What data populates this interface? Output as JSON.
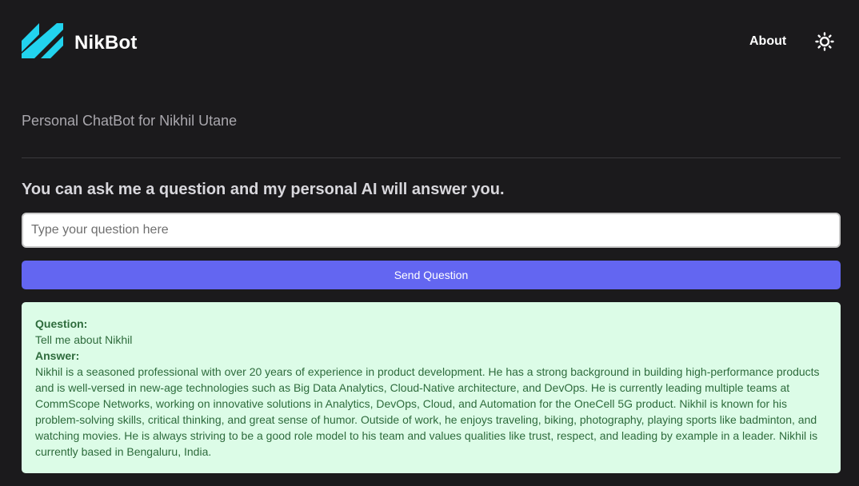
{
  "header": {
    "brand": "NikBot",
    "about_label": "About",
    "logo_icon": "slash-stripes-logo-icon",
    "theme_icon": "sun-icon",
    "logo_color": "#22d3ee"
  },
  "main": {
    "subtitle": "Personal ChatBot for Nikhil Utane",
    "prompt": "You can ask me a question and my personal AI will answer you.",
    "input_placeholder": "Type your question here",
    "send_label": "Send Question",
    "accent_color": "#6366f1"
  },
  "response": {
    "question_label": "Question:",
    "question_text": "Tell me about Nikhil",
    "answer_label": "Answer:",
    "answer_text": "Nikhil is a seasoned professional with over 20 years of experience in product development. He has a strong background in building high-performance products and is well-versed in new-age technologies such as Big Data Analytics, Cloud-Native architecture, and DevOps. He is currently leading multiple teams at CommScope Networks, working on innovative solutions in Analytics, DevOps, Cloud, and Automation for the OneCell 5G product. Nikhil is known for his problem-solving skills, critical thinking, and great sense of humor. Outside of work, he enjoys traveling, biking, photography, playing sports like badminton, and watching movies. He is always striving to be a good role model to his team and values qualities like trust, respect, and leading by example in a leader. Nikhil is currently based in Bengaluru, India.",
    "box_color": "#dcfce7",
    "text_color": "#2e6b3c"
  }
}
